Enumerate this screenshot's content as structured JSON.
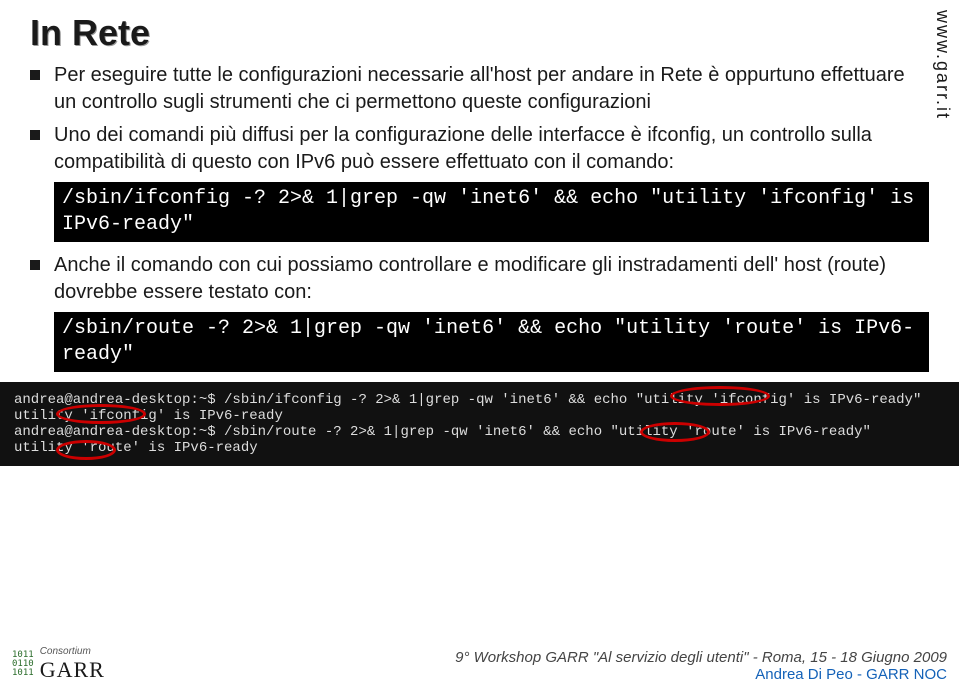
{
  "title": "In Rete",
  "vertical_url": "www.garr.it",
  "bullets": {
    "b1": "Per eseguire tutte le configurazioni necessarie all'host per andare in Rete è oppurtuno effettuare un controllo sugli strumenti che ci permettono queste configurazioni",
    "b2": "Uno dei comandi più diffusi per la configurazione delle interfacce è ifconfig, un controllo sulla compatibilità di questo con IPv6 può essere effettuato con il comando:",
    "b3": "Anche il comando con cui possiamo controllare e modificare gli instradamenti dell' host (route) dovrebbe essere testato con:"
  },
  "code1": "/sbin/ifconfig -? 2>& 1|grep -qw 'inet6' && echo \"utility 'ifconfig' is IPv6-ready\"",
  "code2": "/sbin/route -? 2>& 1|grep -qw 'inet6' && echo \"utility 'route' is IPv6-ready\"",
  "terminal": {
    "l1": "andrea@andrea-desktop:~$ /sbin/ifconfig -? 2>& 1|grep -qw 'inet6' && echo \"utility 'ifconfig' is IPv6-ready\"",
    "l2": "utility 'ifconfig' is IPv6-ready",
    "l3": "andrea@andrea-desktop:~$ /sbin/route -? 2>& 1|grep -qw 'inet6' && echo \"utility 'route' is IPv6-ready\"",
    "l4": "utility 'route' is IPv6-ready"
  },
  "footer": {
    "consortium": "Consortium",
    "garr": "GARR",
    "line1": "9° Workshop GARR \"Al servizio degli utenti\" - Roma, 15 - 18 Giugno 2009",
    "line2": "Andrea Di Peo - GARR NOC"
  }
}
